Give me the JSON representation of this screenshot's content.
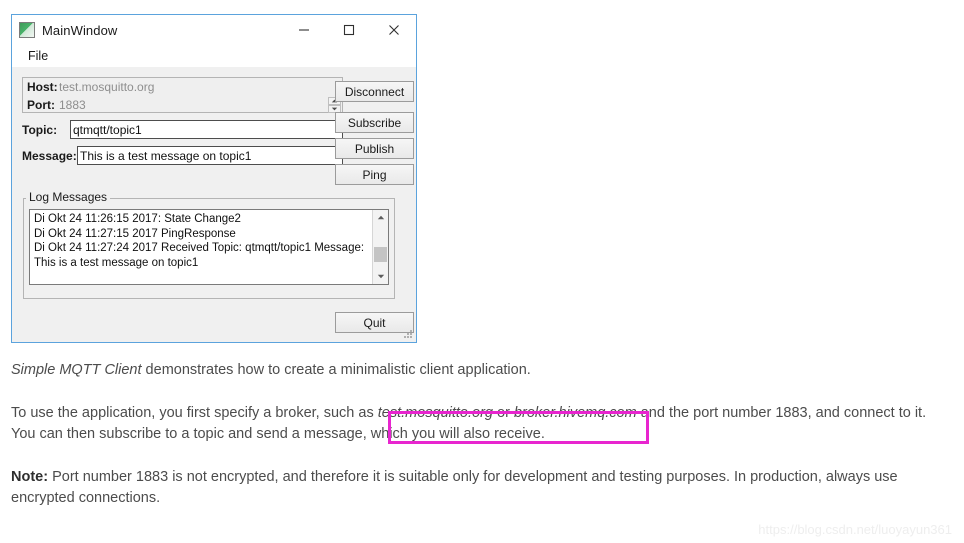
{
  "window": {
    "title": "MainWindow",
    "icon": "app-icon",
    "controls": {
      "minimize": "minimize-icon",
      "maximize": "maximize-icon",
      "close": "close-icon"
    },
    "menu": {
      "items": [
        "File"
      ]
    },
    "border_color": "#5ba3dd"
  },
  "form": {
    "host": {
      "label": "Host:",
      "value": "test.mosquitto.org",
      "disabled": true
    },
    "port": {
      "label": "Port:",
      "value": "1883",
      "disabled": true
    },
    "topic": {
      "label": "Topic:",
      "value": "qtmqtt/topic1",
      "placeholder": ""
    },
    "message": {
      "label": "Message:",
      "value": "This is a test message on topic1",
      "placeholder": ""
    }
  },
  "buttons": {
    "disconnect": "Disconnect",
    "subscribe": "Subscribe",
    "publish": "Publish",
    "ping": "Ping",
    "quit": "Quit"
  },
  "log": {
    "legend": "Log Messages",
    "lines": [
      "Di Okt 24 11:26:15 2017: State Change2",
      "Di Okt 24 11:27:15 2017 PingResponse",
      "Di Okt 24 11:27:24 2017 Received Topic: qtmqtt/topic1 Message: This is a test message on topic1"
    ]
  },
  "doc": {
    "paragraph1": {
      "emphasis": "Simple MQTT Client",
      "rest": " demonstrates how to create a minimalistic client application."
    },
    "paragraph2": {
      "part1": "To use the application, you first specify a broker, such as ",
      "broker1": "test.mosquitto.org",
      "conjunction": " or ",
      "broker2": "broker.hivemq.com",
      "part2": " and the port number 1883, and connect to it. You can then subscribe to a topic and send a message, which you will also receive."
    },
    "paragraph3": {
      "label": "Note:",
      "text": " Port number 1883 is not encrypted, and therefore it is suitable only for development and testing purposes. In production, always use encrypted connections."
    }
  },
  "annotation": {
    "highlight_color": "#e825cf"
  },
  "watermark": "https://blog.csdn.net/luoyayun361"
}
